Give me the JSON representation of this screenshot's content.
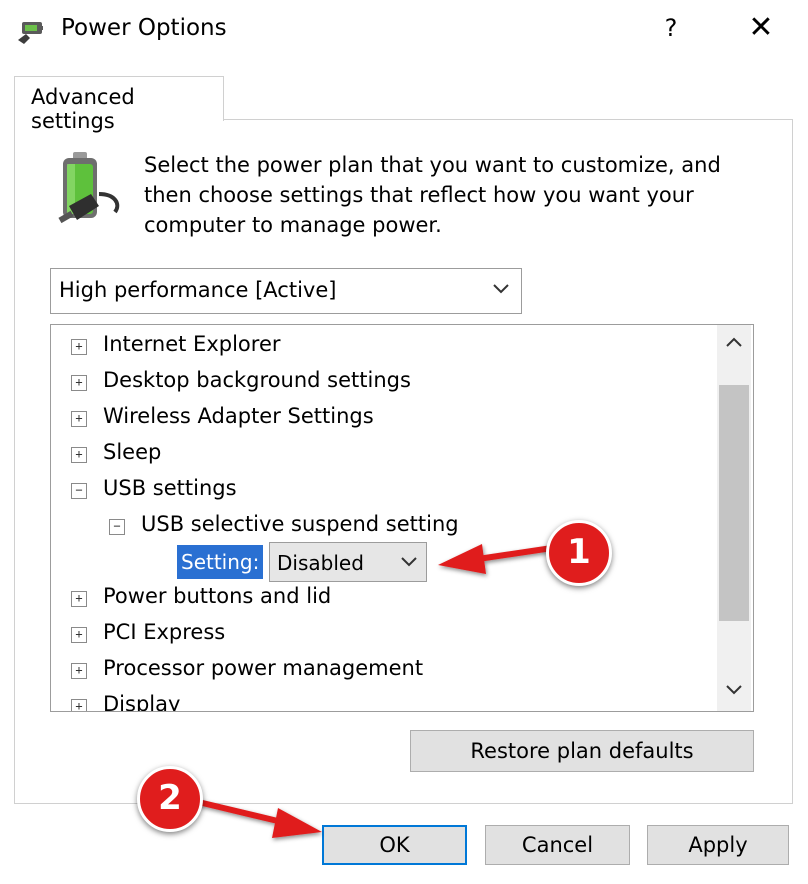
{
  "window": {
    "title": "Power Options",
    "help_label": "?",
    "close_label": "✕"
  },
  "tab": {
    "label": "Advanced settings"
  },
  "intro": {
    "text": "Select the power plan that you want to customize, and then choose settings that reflect how you want your computer to manage power."
  },
  "plan": {
    "selected": "High performance [Active]"
  },
  "tree": {
    "items": [
      {
        "label": "Internet Explorer",
        "expander": "+"
      },
      {
        "label": "Desktop background settings",
        "expander": "+"
      },
      {
        "label": "Wireless Adapter Settings",
        "expander": "+"
      },
      {
        "label": "Sleep",
        "expander": "+"
      },
      {
        "label": "USB settings",
        "expander": "−"
      },
      {
        "label": "USB selective suspend setting",
        "expander": "−"
      },
      {
        "label": "Power buttons and lid",
        "expander": "+"
      },
      {
        "label": "PCI Express",
        "expander": "+"
      },
      {
        "label": "Processor power management",
        "expander": "+"
      },
      {
        "label": "Display",
        "expander": "+"
      }
    ],
    "setting": {
      "label": "Setting:",
      "value": "Disabled"
    }
  },
  "buttons": {
    "restore": "Restore plan defaults",
    "ok": "OK",
    "cancel": "Cancel",
    "apply": "Apply"
  },
  "annotations": {
    "badge_1": "1",
    "badge_2": "2"
  },
  "colors": {
    "accent": "#0078d7",
    "highlight": "#2a70d2",
    "annotation_red": "#e01d1d"
  }
}
